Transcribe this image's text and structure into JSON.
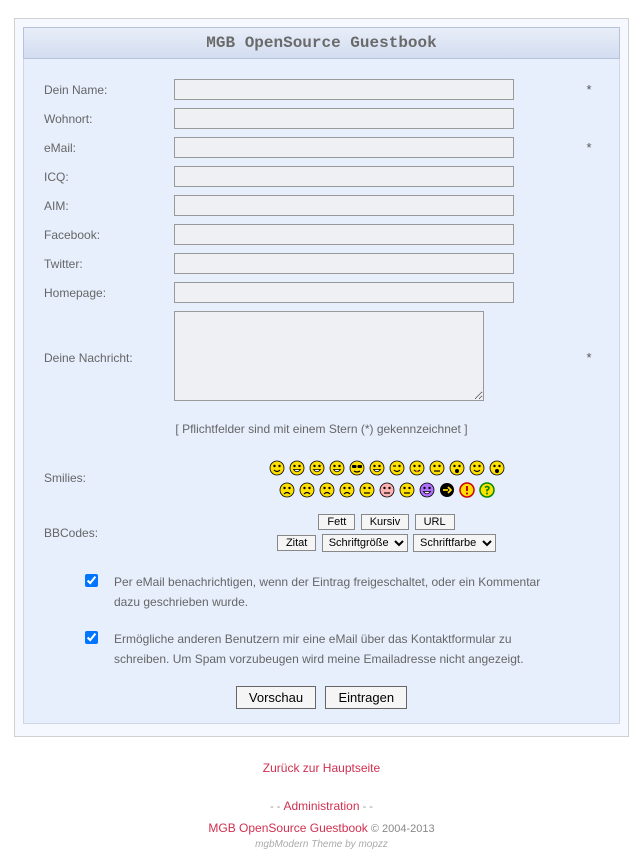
{
  "header": {
    "title": "MGB OpenSource Guestbook"
  },
  "fields": {
    "name": {
      "label": "Dein Name:",
      "req": "*"
    },
    "wohnort": {
      "label": "Wohnort:",
      "req": ""
    },
    "email": {
      "label": "eMail:",
      "req": "*"
    },
    "icq": {
      "label": "ICQ:",
      "req": ""
    },
    "aim": {
      "label": "AIM:",
      "req": ""
    },
    "facebook": {
      "label": "Facebook:",
      "req": ""
    },
    "twitter": {
      "label": "Twitter:",
      "req": ""
    },
    "homepage": {
      "label": "Homepage:",
      "req": ""
    },
    "message": {
      "label": "Deine Nachricht:",
      "req": "*"
    }
  },
  "hint": "[ Pflichtfelder sind mit einem Stern (*) gekennzeichnet ]",
  "smilies_label": "Smilies:",
  "smilies": [
    {
      "n": "smile",
      "f": "#ffe000",
      "m": "smile"
    },
    {
      "n": "grin",
      "f": "#ffe000",
      "m": "grin"
    },
    {
      "n": "biggrin",
      "f": "#ffe000",
      "m": "grin"
    },
    {
      "n": "laugh",
      "f": "#ffe000",
      "m": "grin"
    },
    {
      "n": "cool",
      "f": "#ffe000",
      "m": "cool"
    },
    {
      "n": "lol",
      "f": "#ffe000",
      "m": "grin"
    },
    {
      "n": "wink",
      "f": "#ffe000",
      "m": "wink"
    },
    {
      "n": "tongue",
      "f": "#ffe000",
      "m": "tongue"
    },
    {
      "n": "neutral",
      "f": "#ffe000",
      "m": "flat"
    },
    {
      "n": "confused",
      "f": "#ffe000",
      "m": "oh"
    },
    {
      "n": "rolleyes",
      "f": "#ffe000",
      "m": "smile"
    },
    {
      "n": "eek",
      "f": "#ffe000",
      "m": "oh"
    },
    {
      "n": "sad",
      "f": "#ffe000",
      "m": "sad"
    },
    {
      "n": "frown",
      "f": "#ffe000",
      "m": "sad"
    },
    {
      "n": "cry",
      "f": "#ffe000",
      "m": "sad"
    },
    {
      "n": "mad",
      "f": "#ffe000",
      "m": "sad"
    },
    {
      "n": "embarrassed",
      "f": "#ffe000",
      "m": "flat"
    },
    {
      "n": "redface",
      "f": "#ffb0b0",
      "m": "flat"
    },
    {
      "n": "sleep",
      "f": "#ffe000",
      "m": "flat"
    },
    {
      "n": "evil",
      "f": "#b070ff",
      "m": "grin"
    },
    {
      "n": "arrow",
      "f": "#000000",
      "m": "arrow"
    },
    {
      "n": "exclaim",
      "f": "#ffe000",
      "m": "excl"
    },
    {
      "n": "question",
      "f": "#ffe000",
      "m": "quest"
    }
  ],
  "bbcodes_label": "BBCodes:",
  "bbcodes": {
    "fett": "Fett",
    "kursiv": "Kursiv",
    "url": "URL",
    "zitat": "Zitat",
    "schriftgroesse": "Schriftgröße",
    "schriftfarbe": "Schriftfarbe"
  },
  "checkboxes": {
    "notify": "Per eMail benachrichtigen, wenn der Eintrag freigeschaltet, oder ein Kommentar dazu geschrieben wurde.",
    "contact": "Ermögliche anderen Benutzern mir eine eMail über das Kontaktformular zu schreiben. Um Spam vorzubeugen wird meine Emailadresse nicht angezeigt."
  },
  "buttons": {
    "vorschau": "Vorschau",
    "eintragen": "Eintragen"
  },
  "footer": {
    "back": "Zurück zur Hauptseite",
    "admin": "Administration",
    "dashes": "- -",
    "product": "MGB OpenSource Guestbook",
    "copyright": "© 2004-2013",
    "theme": "mgbModern Theme by mopzz"
  }
}
